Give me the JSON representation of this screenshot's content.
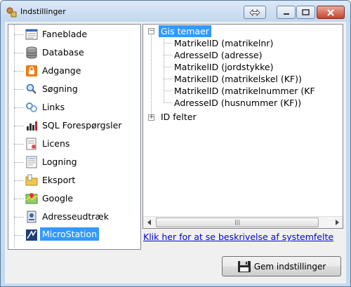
{
  "window": {
    "title": "Indstillinger"
  },
  "nav": {
    "items": [
      {
        "label": "Faneblade",
        "icon": "tabs-icon"
      },
      {
        "label": "Database",
        "icon": "database-icon"
      },
      {
        "label": "Adgange",
        "icon": "lock-icon"
      },
      {
        "label": "Søgning",
        "icon": "search-icon"
      },
      {
        "label": "Links",
        "icon": "link-icon"
      },
      {
        "label": "SQL Forespørgsler",
        "icon": "sql-icon"
      },
      {
        "label": "Licens",
        "icon": "license-icon"
      },
      {
        "label": "Logning",
        "icon": "log-icon"
      },
      {
        "label": "Eksport",
        "icon": "export-icon"
      },
      {
        "label": "Google",
        "icon": "google-icon"
      },
      {
        "label": "Adresseudtræk",
        "icon": "address-icon"
      },
      {
        "label": "MicroStation",
        "icon": "microstation-icon"
      }
    ],
    "selected": "MicroStation"
  },
  "tree": {
    "root1": "Gis temaer",
    "children": [
      "MatrikelID (matrikelnr)",
      "AdresseID (adresse)",
      "MatrikelID (jordstykke)",
      "MatrikelID (matrikelskel (KF))",
      "MatrikelID (matrikelnummer (KF",
      "AdresseID (husnummer (KF))"
    ],
    "root2": "ID felter"
  },
  "link_text": "Klik her for at se beskrivelse af systemfelte",
  "save_label": "Gem indstillinger"
}
